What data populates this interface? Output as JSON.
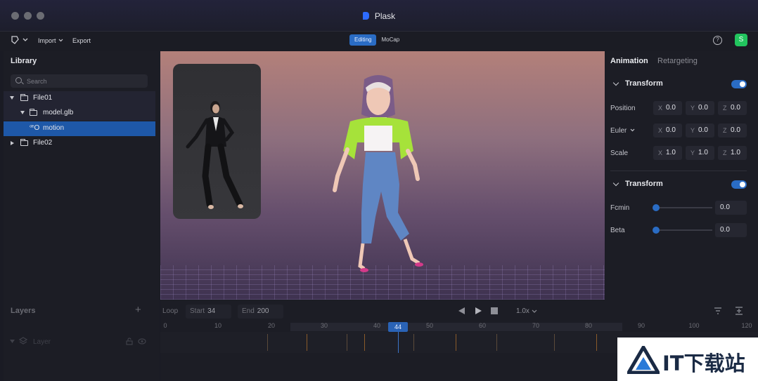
{
  "window": {
    "title": "Plask"
  },
  "toolbar": {
    "import_label": "Import",
    "export_label": "Export",
    "modes": [
      "Editing",
      "MoCap"
    ],
    "active_mode": "Editing",
    "avatar_letter": "S"
  },
  "library": {
    "title": "Library",
    "search_placeholder": "Search",
    "items": [
      {
        "label": "File01",
        "type": "folder",
        "expanded": true
      },
      {
        "label": "model.glb",
        "type": "folder",
        "expanded": true
      },
      {
        "label": "motion",
        "type": "motion",
        "selected": true
      },
      {
        "label": "File02",
        "type": "folder",
        "expanded": false
      }
    ]
  },
  "layers": {
    "title": "Layers",
    "rows": [
      {
        "label": "Layer"
      }
    ]
  },
  "timeline": {
    "loop_label": "Loop",
    "start_label": "Start",
    "start_value": "34",
    "end_label": "End",
    "end_value": "200",
    "speed": "1.0x",
    "ticks": [
      "0",
      "10",
      "20",
      "30",
      "40",
      "50",
      "60",
      "70",
      "80",
      "90",
      "100",
      "120"
    ],
    "current_frame": "44"
  },
  "properties": {
    "tabs": [
      "Animation",
      "Retargeting"
    ],
    "active_tab": "Animation",
    "transform1": {
      "title": "Transform",
      "enabled": true,
      "rows": [
        {
          "label": "Position",
          "x": "0.0",
          "y": "0.0",
          "z": "0.0"
        },
        {
          "label": "Euler",
          "x": "0.0",
          "y": "0.0",
          "z": "0.0"
        },
        {
          "label": "Scale",
          "x": "1.0",
          "y": "1.0",
          "z": "1.0"
        }
      ]
    },
    "transform2": {
      "title": "Transform",
      "enabled": true,
      "rows": [
        {
          "label": "Fcmin",
          "value": "0.0",
          "level": 0
        },
        {
          "label": "Beta",
          "value": "0.0",
          "level": 0
        }
      ]
    }
  },
  "watermark": {
    "text": "IT下载站"
  },
  "colors": {
    "accent": "#2a6cc4",
    "avatar": "#22c55e"
  }
}
